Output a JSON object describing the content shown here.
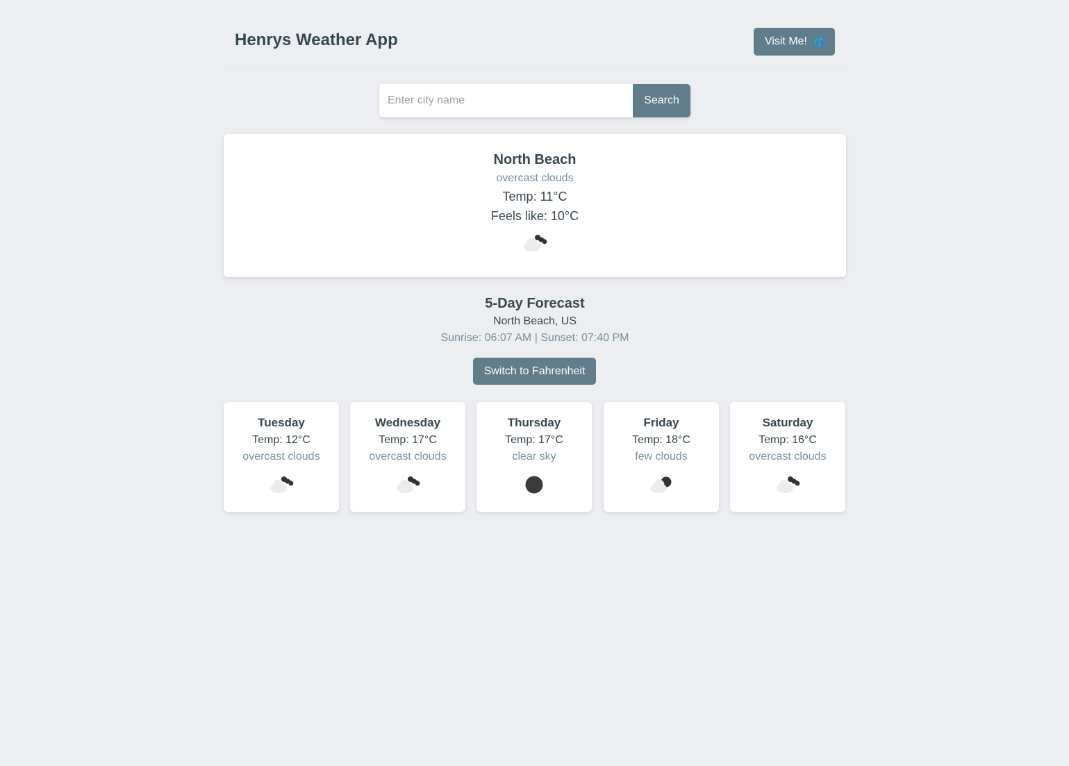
{
  "header": {
    "title": "Henrys Weather App",
    "visit_label": "Visit Me!",
    "visit_icon": "globe-icon"
  },
  "search": {
    "placeholder": "Enter city name",
    "value": "",
    "button_label": "Search"
  },
  "current": {
    "city": "North Beach",
    "description": "overcast clouds",
    "temp": "Temp: 11°C",
    "feels_like": "Feels like: 10°C",
    "icon": "overcast-clouds-icon"
  },
  "forecast": {
    "title": "5-Day Forecast",
    "location": "North Beach, US",
    "sun_times": "Sunrise: 06:07 AM |  Sunset: 07:40 PM",
    "unit_toggle_label": "Switch to Fahrenheit",
    "days": [
      {
        "day": "Tuesday",
        "temp": "Temp: 12°C",
        "description": "overcast clouds",
        "icon": "overcast-clouds-icon"
      },
      {
        "day": "Wednesday",
        "temp": "Temp: 17°C",
        "description": "overcast clouds",
        "icon": "overcast-clouds-icon"
      },
      {
        "day": "Thursday",
        "temp": "Temp: 17°C",
        "description": "clear sky",
        "icon": "clear-sky-icon"
      },
      {
        "day": "Friday",
        "temp": "Temp: 18°C",
        "description": "few clouds",
        "icon": "few-clouds-icon"
      },
      {
        "day": "Saturday",
        "temp": "Temp: 16°C",
        "description": "overcast clouds",
        "icon": "overcast-clouds-icon"
      }
    ]
  },
  "colors": {
    "background": "#eceef1",
    "accent": "#607d8b",
    "card": "#ffffff",
    "text": "#37474f",
    "muted": "#78909c"
  }
}
